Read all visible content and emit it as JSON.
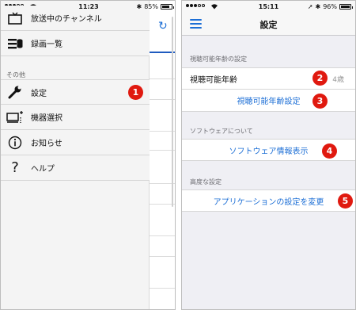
{
  "left_screen": {
    "status": {
      "time": "11:23",
      "battery": "85%",
      "battery_level": 0.85
    },
    "drawer": {
      "items_top": [
        {
          "label": "放送中のチャンネル",
          "icon": "tv-icon"
        },
        {
          "label": "録画一覧",
          "icon": "recording-list-icon"
        }
      ],
      "section_label": "その他",
      "items_other": [
        {
          "label": "設定",
          "icon": "wrench-icon"
        },
        {
          "label": "機器選択",
          "icon": "device-select-icon"
        },
        {
          "label": "お知らせ",
          "icon": "info-icon"
        },
        {
          "label": "ヘルプ",
          "icon": "question-mark-icon"
        }
      ]
    },
    "badge_1": "1"
  },
  "right_screen": {
    "status": {
      "time": "15:11",
      "battery": "96%",
      "battery_level": 0.96
    },
    "nav_title": "設定",
    "groups": [
      {
        "header": "視聴可能年齢の設定",
        "rows": [
          {
            "label": "視聴可能年齢",
            "value": "4歳"
          },
          {
            "label": "視聴可能年齢設定"
          }
        ]
      },
      {
        "header": "ソフトウェアについて",
        "rows": [
          {
            "label": "ソフトウェア情報表示"
          }
        ]
      },
      {
        "header": "高度な設定",
        "rows": [
          {
            "label": "アプリケーションの設定を変更"
          }
        ]
      }
    ],
    "badges": [
      "2",
      "3",
      "4",
      "5"
    ]
  },
  "colors": {
    "accent": "#1d6fd6",
    "badge_red": "#e0190f",
    "group_bg": "#efeff4"
  }
}
